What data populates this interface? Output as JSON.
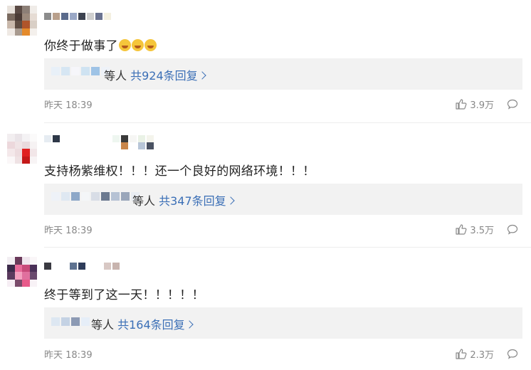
{
  "comments": [
    {
      "text": "你终于做事了",
      "emojis": [
        "crying-face-icon",
        "crying-face-icon",
        "crying-face-icon"
      ],
      "reply_suffix": "等人",
      "reply_link": "共924条回复",
      "time": "昨天 18:39",
      "likes": "3.9万"
    },
    {
      "text": "支持杨紫维权！！！还一个良好的网络环境！！！",
      "emojis": [],
      "reply_suffix": "等人",
      "reply_link": "共347条回复",
      "time": "昨天 18:39",
      "likes": "3.5万"
    },
    {
      "text": "终于等到了这一天！！！！！",
      "emojis": [],
      "reply_suffix": "等人",
      "reply_link": "共164条回复",
      "time": "昨天 18:39",
      "likes": "2.3万"
    }
  ],
  "colors": {
    "reply_link": "#3b6fb6",
    "reply_box_bg": "#f2f2f2",
    "meta_text": "#888888"
  }
}
